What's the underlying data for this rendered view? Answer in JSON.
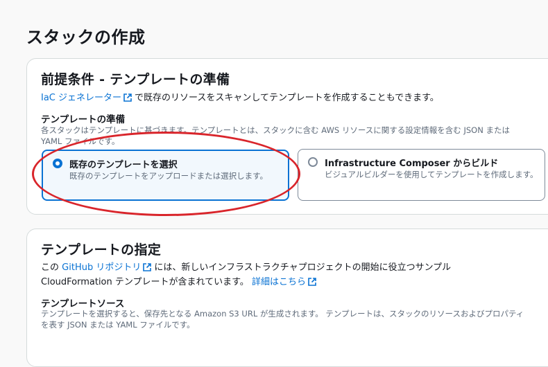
{
  "page": {
    "title": "スタックの作成"
  },
  "prereq": {
    "title": "前提条件 - テンプレートの準備",
    "iac_link": "IaC ジェネレーター",
    "iac_text": "で既存のリソースをスキャンしてテンプレートを作成することもできます。",
    "prepare_label": "テンプレートの準備",
    "prepare_desc_line1": "各スタックはテンプレートに基づきます。テンプレートとは、スタックに含む AWS リソースに関する設定情報を含む JSON または",
    "prepare_desc_line2": "YAML ファイルです。",
    "options": [
      {
        "title": "既存のテンプレートを選択",
        "desc": "既存のテンプレートをアップロードまたは選択します。",
        "selected": true
      },
      {
        "title": "Infrastructure Composer からビルド",
        "desc": "ビジュアルビルダーを使用してテンプレートを作成します。",
        "selected": false
      }
    ]
  },
  "spec": {
    "title": "テンプレートの指定",
    "line1_pre": "この",
    "github_link": "GitHub リポジトリ",
    "line1_post": "には、新しいインフラストラクチャプロジェクトの開始に役立つサンプル",
    "line2_pre": "CloudFormation テンプレートが含まれています。",
    "details_link": "詳細はこちら",
    "source_label": "テンプレートソース",
    "source_desc_line1": "テンプレートを選択すると、保存先となる Amazon S3 URL が生成されます。 テンプレートは、スタックのリソースおよびプロパティ",
    "source_desc_line2": "を表す JSON または YAML ファイルです。"
  },
  "colors": {
    "link": "#0972d3",
    "selected_border": "#0972d3",
    "annotation": "#d9252b"
  }
}
